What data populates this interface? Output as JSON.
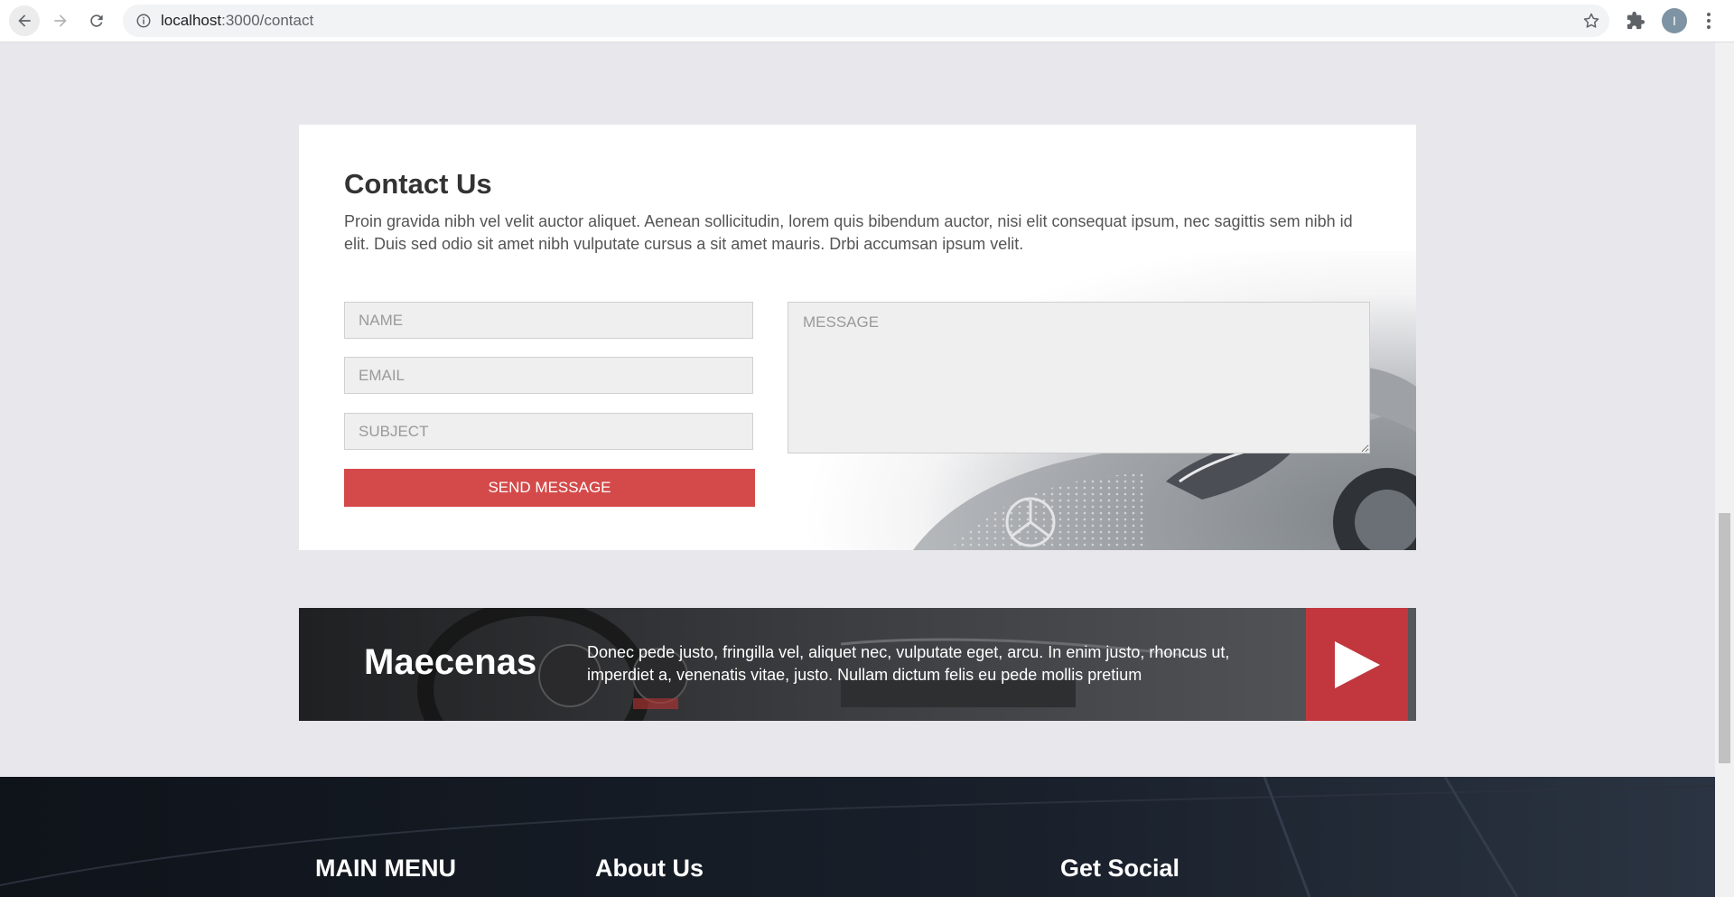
{
  "browser": {
    "url_host": "localhost",
    "url_path": ":3000/contact",
    "profile_initial": "I"
  },
  "contact": {
    "title": "Contact Us",
    "description": "Proin gravida nibh vel velit auctor aliquet. Aenean sollicitudin, lorem quis bibendum auctor, nisi elit consequat ipsum, nec sagittis sem nibh id elit. Duis sed odio sit amet nibh vulputate cursus a sit amet mauris. Drbi accumsan ipsum velit.",
    "name_placeholder": "NAME",
    "email_placeholder": "EMAIL",
    "subject_placeholder": "SUBJECT",
    "message_placeholder": "MESSAGE",
    "send_label": "SEND MESSAGE"
  },
  "banner": {
    "title": "Maecenas",
    "text": "Donec pede justo, fringilla vel, aliquet nec, vulputate eget, arcu. In enim justo, rhoncus ut, imperdiet a, venenatis vitae, justo. Nullam dictum felis eu pede mollis pretium"
  },
  "footer": {
    "main_menu": "MAIN MENU",
    "about_us": "About Us",
    "get_social": "Get Social"
  },
  "colors": {
    "accent_red": "#d44a4a",
    "play_red": "#c1373d",
    "page_bg": "#e8e7ec",
    "footer_bg": "#141922"
  }
}
